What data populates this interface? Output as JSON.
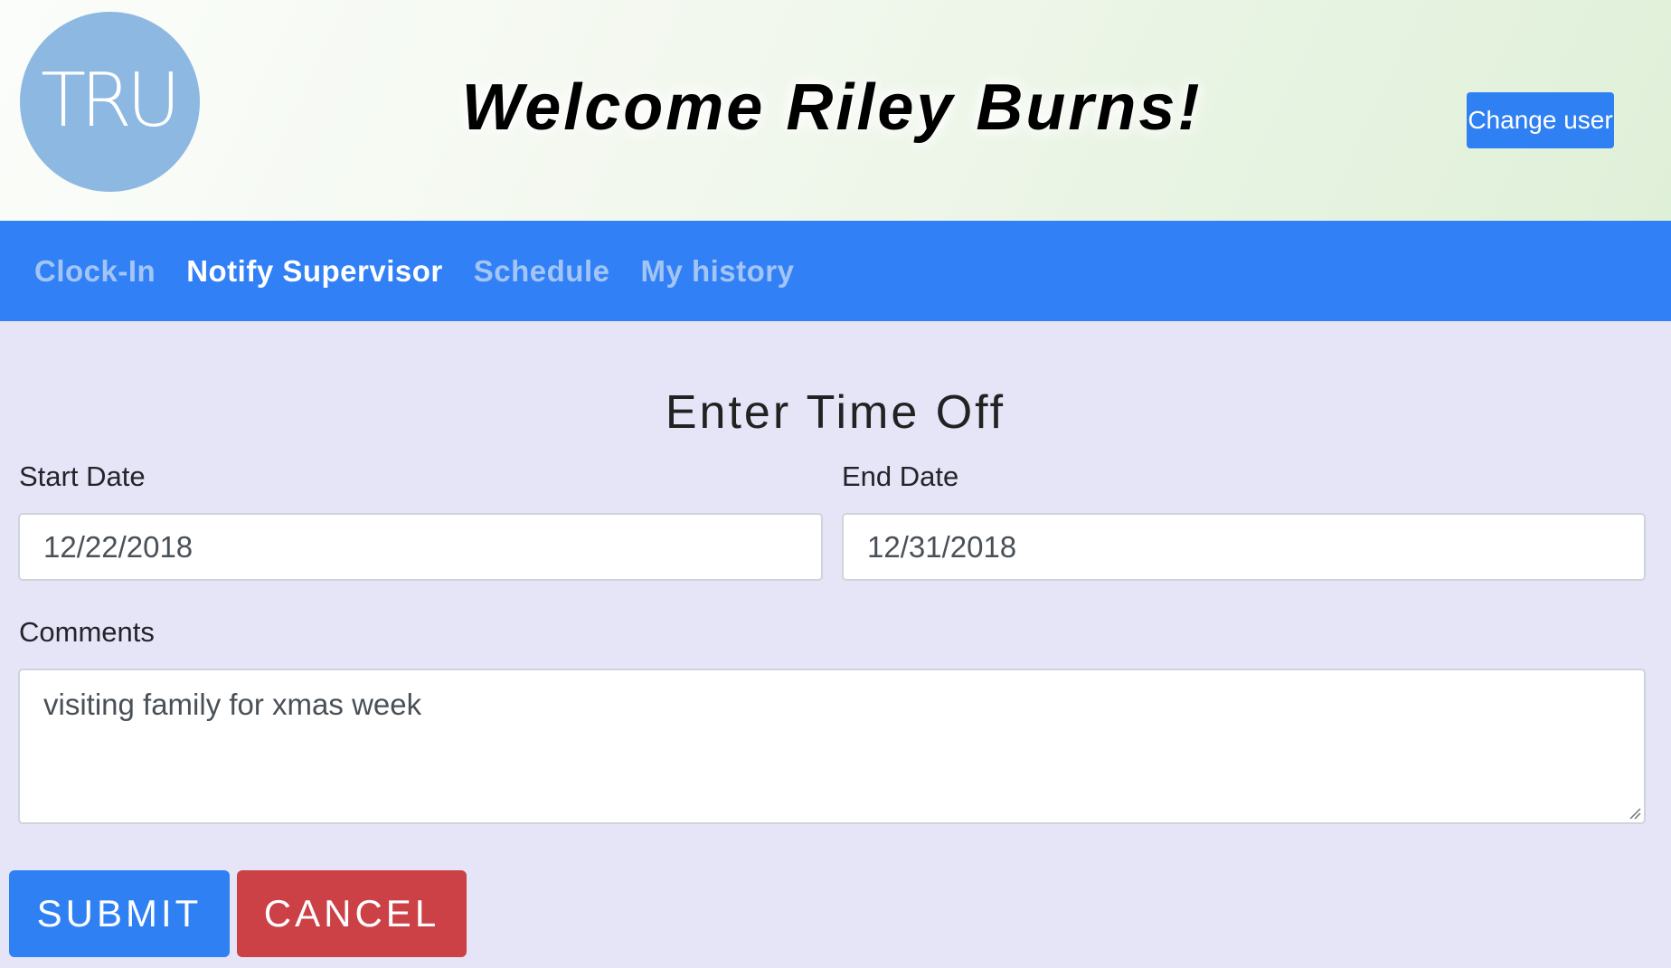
{
  "header": {
    "logo_text": "TRU",
    "welcome": "Welcome Riley Burns!",
    "change_user_label": "Change user"
  },
  "nav": {
    "items": [
      {
        "label": "Clock-In",
        "active": false
      },
      {
        "label": "Notify Supervisor",
        "active": true
      },
      {
        "label": "Schedule",
        "active": false
      },
      {
        "label": "My history",
        "active": false
      }
    ]
  },
  "form": {
    "title": "Enter Time Off",
    "start_date_label": "Start Date",
    "start_date_value": "12/22/2018",
    "end_date_label": "End Date",
    "end_date_value": "12/31/2018",
    "comments_label": "Comments",
    "comments_value": "visiting family for xmas week",
    "submit_label": "SUBMIT",
    "cancel_label": "CANCEL"
  },
  "colors": {
    "primary": "#2f80f2",
    "navbar": "#3280f6",
    "danger": "#cb4146",
    "page_bg": "#e6e5f7",
    "logo": "#8db8e2",
    "nav_inactive_text": "#a3c5f5"
  }
}
